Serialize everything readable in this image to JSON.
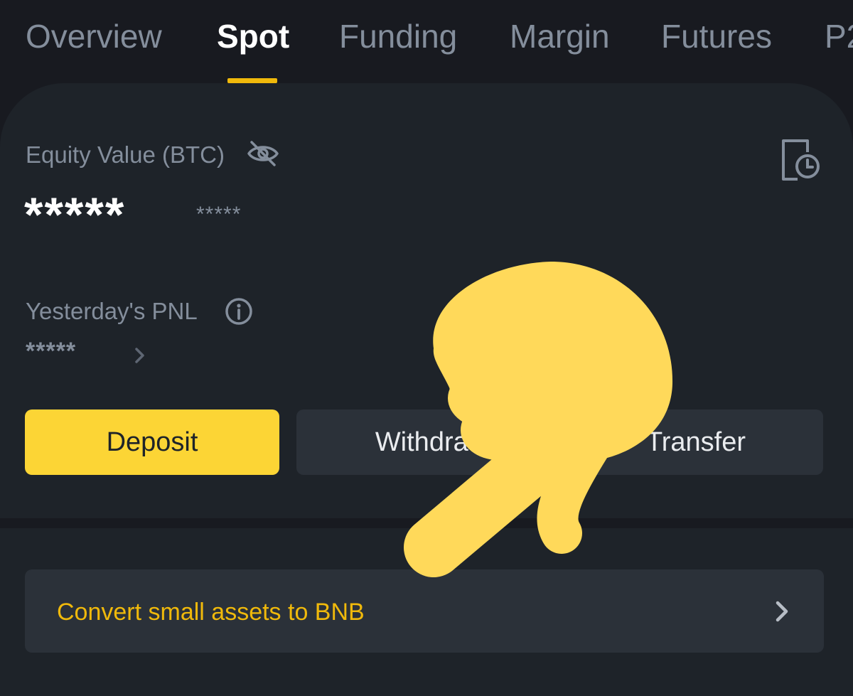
{
  "tabs": {
    "items": [
      {
        "label": "Overview"
      },
      {
        "label": "Spot"
      },
      {
        "label": "Funding"
      },
      {
        "label": "Margin"
      },
      {
        "label": "Futures"
      },
      {
        "label": "P2"
      }
    ],
    "active": "Spot"
  },
  "equity": {
    "label": "Equity Value (BTC)",
    "value": "*****",
    "sub_value": "*****"
  },
  "pnl": {
    "label": "Yesterday's PNL",
    "value": "*****"
  },
  "actions": {
    "deposit_label": "Deposit",
    "withdraw_label": "Withdraw",
    "transfer_label": "Transfer"
  },
  "convert": {
    "label": "Convert small assets to BNB"
  },
  "icons": {
    "visibility_toggle": "eye-slash-icon",
    "history": "history-icon",
    "info": "info-icon",
    "chevron": "chevron-right-icon",
    "overlay": "pointing-hand-icon"
  },
  "colors": {
    "background": "#181A20",
    "card": "#1E2329",
    "button_secondary": "#2B3139",
    "accent": "#F0B90B",
    "deposit_button": "#FCD535",
    "text_primary": "#FFFFFF",
    "text_secondary": "#848E9C",
    "hand": "#FFD95A"
  }
}
